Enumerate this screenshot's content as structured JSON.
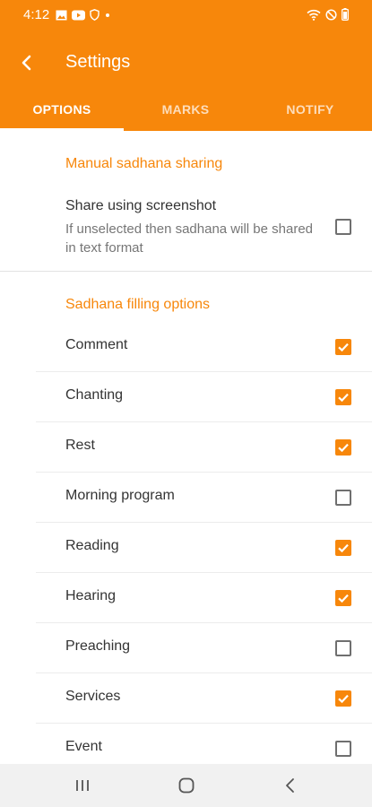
{
  "status_bar": {
    "time": "4:12",
    "left_icons": [
      "gallery-icon",
      "youtube-icon",
      "shield-icon",
      "dot-icon"
    ],
    "right_icons": [
      "wifi-icon",
      "do-not-disturb-icon",
      "battery-icon"
    ]
  },
  "app_bar": {
    "title": "Settings",
    "back_icon": "back-arrow-icon",
    "color": "#F7870B"
  },
  "tabs": [
    {
      "label": "OPTIONS",
      "active": true
    },
    {
      "label": "MARKS",
      "active": false
    },
    {
      "label": "NOTIFY",
      "active": false
    }
  ],
  "manual_sharing": {
    "header": "Manual sadhana sharing",
    "share_title": "Share using screenshot",
    "share_subtitle": "If unselected then sadhana will be shared in text format",
    "checked": false
  },
  "filling_options": {
    "header": "Sadhana filling options",
    "items": [
      {
        "label": "Comment",
        "checked": true
      },
      {
        "label": "Chanting",
        "checked": true
      },
      {
        "label": "Rest",
        "checked": true
      },
      {
        "label": "Morning program",
        "checked": false
      },
      {
        "label": "Reading",
        "checked": true
      },
      {
        "label": "Hearing",
        "checked": true
      },
      {
        "label": "Preaching",
        "checked": false
      },
      {
        "label": "Services",
        "checked": true
      },
      {
        "label": "Event",
        "checked": false
      }
    ]
  },
  "nav_bar": {
    "icons": [
      "recents-icon",
      "home-icon",
      "back-icon"
    ]
  }
}
